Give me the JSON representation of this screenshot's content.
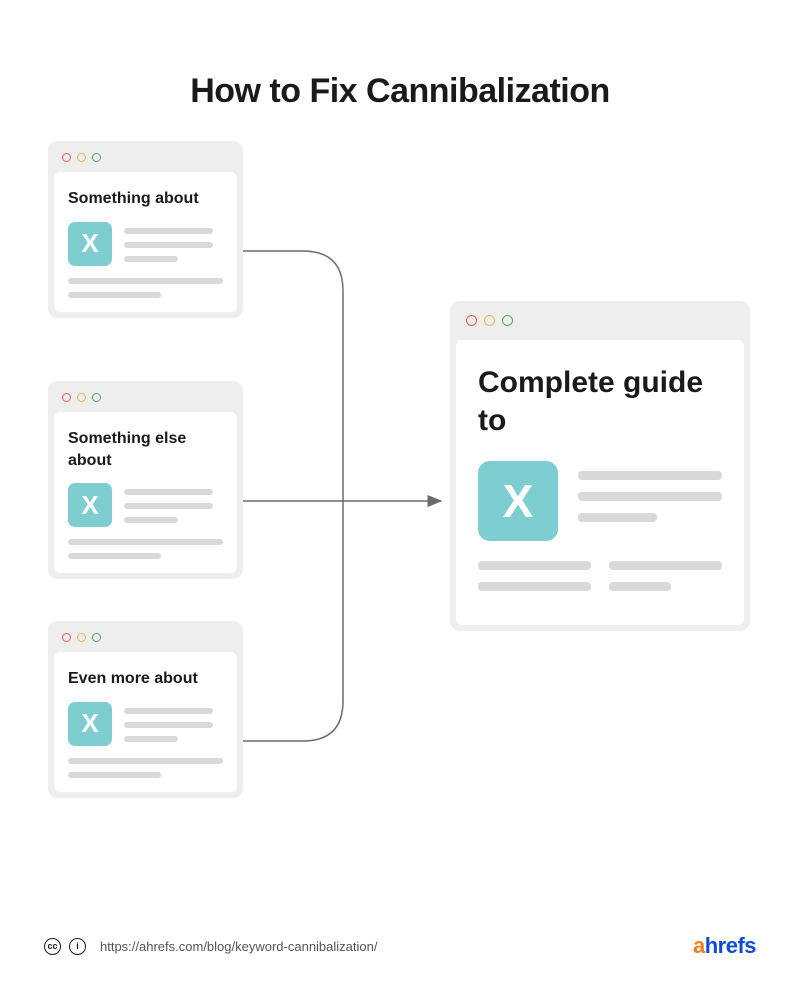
{
  "title": "How to Fix Cannibalization",
  "small_cards": [
    {
      "title": "Something about",
      "box_label": "X"
    },
    {
      "title": "Something else about",
      "box_label": "X"
    },
    {
      "title": "Even more about",
      "box_label": "X"
    }
  ],
  "big_card": {
    "title": "Complete guide to",
    "box_label": "X"
  },
  "footer": {
    "cc_label": "cc",
    "attr_label": "i",
    "url": "https://ahrefs.com/blog/keyword-cannibalization/",
    "brand_a": "a",
    "brand_rest": "hrefs"
  },
  "colors": {
    "accent_teal": "#7ecdd0",
    "brand_orange": "#f37c21",
    "brand_blue": "#0b4dd6"
  }
}
